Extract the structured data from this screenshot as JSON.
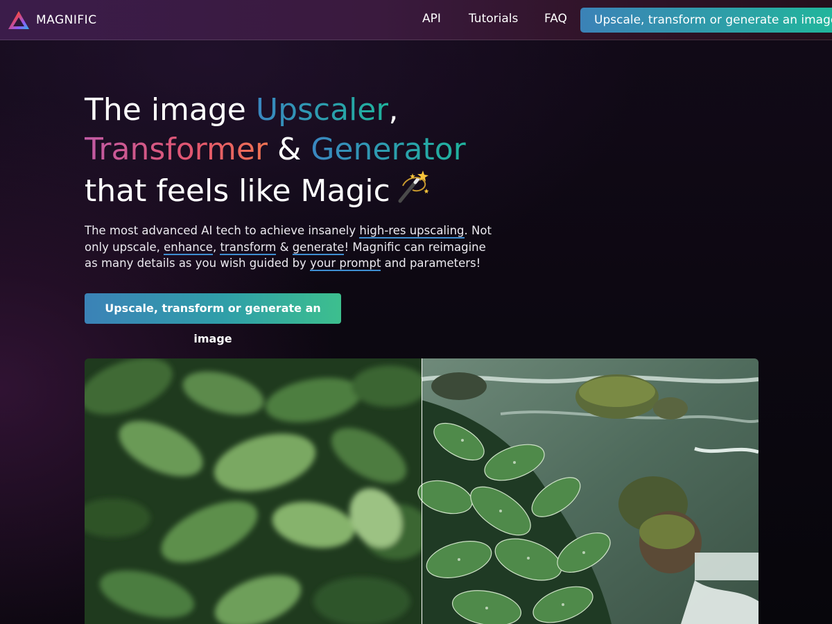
{
  "header": {
    "brand": "MAGNIFIC",
    "nav": [
      {
        "label": "API"
      },
      {
        "label": "Tutorials"
      },
      {
        "label": "FAQ"
      }
    ],
    "cta_label": "Upscale, transform or generate an image"
  },
  "hero": {
    "title": {
      "l1_a": "The image ",
      "l1_b": "Upscaler",
      "l1_c": ",",
      "l2_a": "Transformer",
      "l2_b": " & ",
      "l2_c": "Generator",
      "l3": "that feels like Magic"
    },
    "description": {
      "p1": "The most advanced AI tech to achieve insanely ",
      "link1": "high-res upscaling",
      "p2": ". Not only upscale, ",
      "link2": "enhance",
      "p3": ", ",
      "link3": "transform",
      "p4": " & ",
      "link4": "generate",
      "p5": "! Magnific can reimagine as many details as you wish guided by ",
      "link5": "your prompt",
      "p6": " and parameters!"
    },
    "cta_label": "Upscale, transform or generate an image"
  },
  "comparison": {
    "before_image": "blurry-jungle-leaves",
    "after_image": "sharp-jungle-stream"
  },
  "icons": {
    "logo": "triangle-prism-logo",
    "wand": "magic-wand-icon"
  },
  "colors": {
    "accent_blue": "#3a86c0",
    "accent_teal": "#1fb39c",
    "accent_pink": "#c15aa5",
    "accent_orange": "#ef7352"
  }
}
